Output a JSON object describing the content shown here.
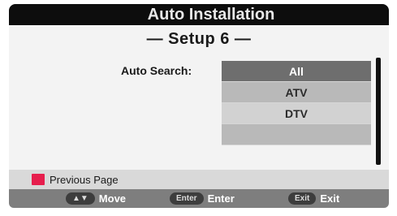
{
  "title": "Auto Installation",
  "subtitle": "— Setup 6 —",
  "auto_search": {
    "label": "Auto Search:",
    "options": [
      "All",
      "ATV",
      "DTV",
      ""
    ],
    "selected": "All"
  },
  "previous_page": {
    "label": "Previous Page",
    "key_color": "#e61e4d"
  },
  "footer": {
    "move": {
      "key": "▲▼",
      "label": "Move"
    },
    "enter": {
      "key": "Enter",
      "label": "Enter"
    },
    "exit": {
      "key": "Exit",
      "label": "Exit"
    }
  }
}
